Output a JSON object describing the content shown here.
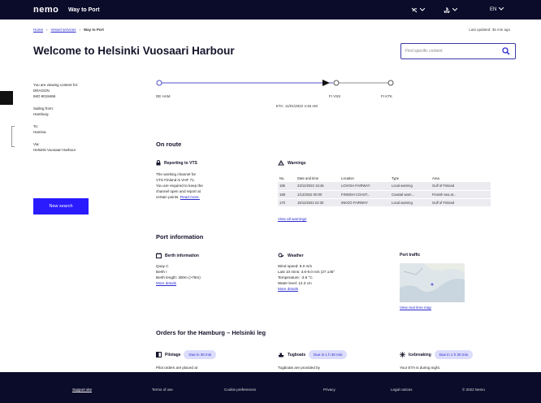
{
  "header": {
    "brand": "nemo",
    "product": "Way to Port",
    "controls": [
      {
        "icon": "notifications-icon",
        "label": ""
      },
      {
        "icon": "ship-icon",
        "label": ""
      },
      {
        "icon": "",
        "label": "EN"
      }
    ]
  },
  "breadcrumb": {
    "items": [
      "Home",
      "Vessel services",
      "Way to Port"
    ]
  },
  "last_updated": "Last updated: 35 min ago",
  "title": "Welcome to Helsinki Vuosaari Harbour",
  "search": {
    "placeholder": "Find specific content"
  },
  "vessel": {
    "viewing_label": "You are viewing content for:",
    "name": "DRAGON",
    "imo": "IMO 9019466",
    "sailing_from_label": "Sailing from:",
    "sailing_from": "Hamburg",
    "to_label": "To:",
    "to": "Hamina",
    "via_label": "Via:",
    "via": "Helsinki Vuosaari Harbour"
  },
  "new_search": "New search",
  "route": {
    "points": [
      "DE HAM",
      "FI VSS",
      "FI KTK"
    ],
    "eta": "ETA: 11/01/2022 4:46 AM"
  },
  "on_route": {
    "title": "On route",
    "vts": {
      "title": "Reporting to VTS",
      "lines": [
        "The working channel for",
        "VTS Finland is VHF 71.",
        "You are required to keep the",
        "channel open and report at"
      ],
      "last_line": "certain points.",
      "link": "Read more."
    },
    "warnings": {
      "title": "Warnings",
      "columns": [
        "No.",
        "Date and time",
        "Location",
        "Type",
        "Area"
      ],
      "rows": [
        [
          "185",
          "23/12/2022 16:45",
          "LOVIISA FAIRWAY",
          "Local warning",
          "Gulf of Finland"
        ],
        [
          "188",
          "1/12/2022 00:00",
          "FINNISH COAST...",
          "Coastal warn...",
          "Finnish sea ar..."
        ],
        [
          "170",
          "15/11/2022 22:30",
          "INKOO FAIRWAY",
          "Local warning",
          "Gulf of Finland"
        ]
      ],
      "link": "View all warnings"
    }
  },
  "port_info": {
    "title": "Port information",
    "berth": {
      "title": "Berth information",
      "lines": [
        "Quay C",
        "Berth I",
        "Berth length: 300m (>78m)"
      ],
      "link": "More details"
    },
    "weather": {
      "title": "Weather",
      "lines": [
        "Wind speed: 8.0 m/s",
        "Last 10 mins: 3.6-9.0 m/s (27.145°",
        "Temperature: -3.6 °C",
        "Water level: 12.3 cm"
      ],
      "link": "More details"
    },
    "traffic": {
      "title": "Port traffic",
      "link": "View real time map"
    }
  },
  "orders": {
    "title": "Orders for the Hamburg – Helsinki leg",
    "items": [
      {
        "title": "Pilotage",
        "due": "Due in 30 min",
        "text": "Pilot orders are placed at"
      },
      {
        "title": "Tugboats",
        "due": "Due in 1 h 30 min",
        "text": "Tugboats are provided by"
      },
      {
        "title": "Icebreaking",
        "due": "Due in 1 h 30 min",
        "text": "Your ETA is during night."
      }
    ]
  },
  "footer": {
    "support": "Support site",
    "links": [
      "Terms of use",
      "Cookie preferences",
      "Privacy",
      "Legal notices"
    ],
    "copyright": "© 2022 Nemo"
  },
  "colors": {
    "nav": "#0b0b2a",
    "accent": "#2a1bff",
    "link": "#2a2ad0",
    "pill": "#dcdcfb"
  }
}
